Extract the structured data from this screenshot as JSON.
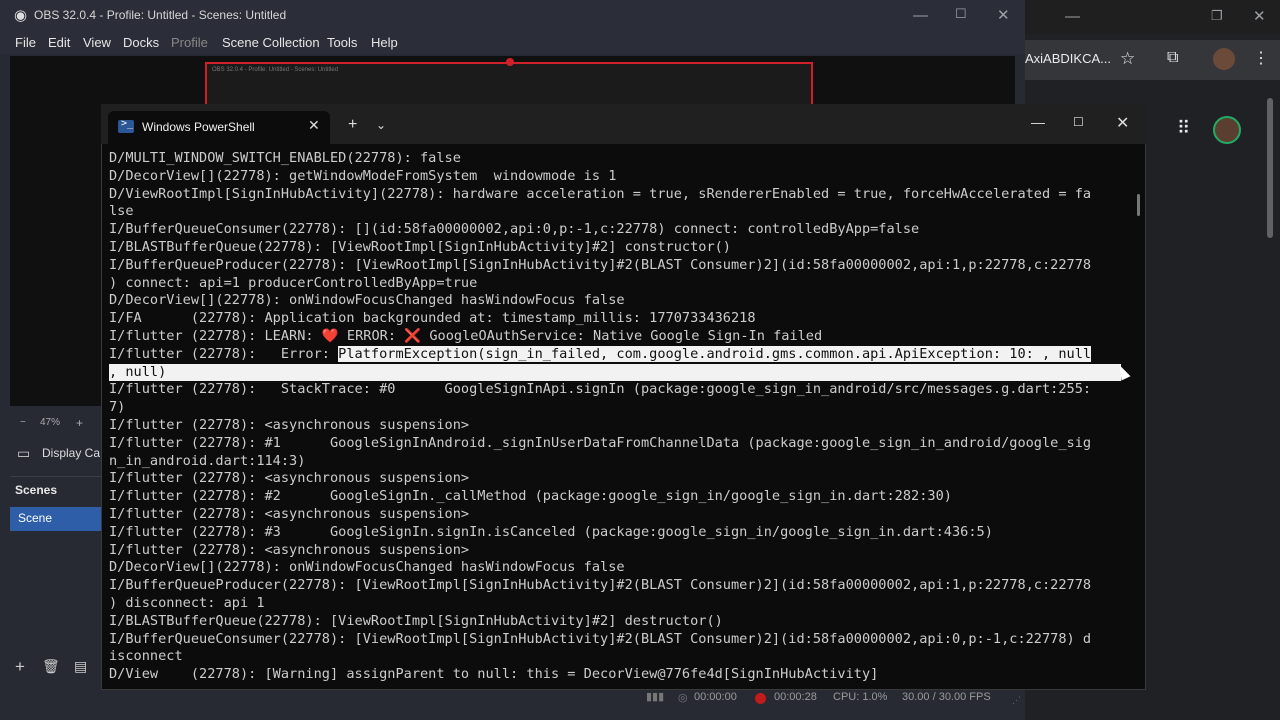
{
  "obs": {
    "title": "OBS 32.0.4 - Profile: Untitled - Scenes: Untitled",
    "menu": [
      "File",
      "Edit",
      "View",
      "Docks",
      "Profile",
      "Scene Collection",
      "Tools",
      "Help"
    ],
    "zoom": "47%",
    "display_capture": "Display Ca",
    "scenes_header": "Scenes",
    "scene_item": "Scene",
    "status": {
      "stream_time": "00:00:00",
      "rec_time": "00:00:28",
      "cpu": "CPU: 1.0%",
      "fps": "30.00 / 30.00 FPS"
    },
    "preview_title": "OBS 32.0.4 - Profile: Untitled - Scenes: Untitled"
  },
  "browser": {
    "address_text": "AxiABDIKCA..."
  },
  "terminal": {
    "tab_title": "Windows PowerShell",
    "lines": [
      "D/MULTI_WINDOW_SWITCH_ENABLED(22778): false",
      "D/DecorView[](22778): getWindowModeFromSystem  windowmode is 1",
      "D/ViewRootImpl[SignInHubActivity](22778): hardware acceleration = true, sRendererEnabled = true, forceHwAccelerated = fa",
      "lse",
      "I/BufferQueueConsumer(22778): [](id:58fa00000002,api:0,p:-1,c:22778) connect: controlledByApp=false",
      "I/BLASTBufferQueue(22778): [ViewRootImpl[SignInHubActivity]#2] constructor()",
      "I/BufferQueueProducer(22778): [ViewRootImpl[SignInHubActivity]#2(BLAST Consumer)2](id:58fa00000002,api:1,p:22778,c:22778",
      ") connect: api=1 producerControlledByApp=true",
      "D/DecorView[](22778): onWindowFocusChanged hasWindowFocus false",
      "I/FA      (22778): Application backgrounded at: timestamp_millis: 1770733436218"
    ],
    "learn_line": {
      "prefix": "I/flutter (22778): LEARN: ",
      "heart": "❤️",
      "mid": " ERROR: ",
      "cross": "❌",
      "suffix": " GoogleOAuthService: Native Google Sign-In failed"
    },
    "error_line": {
      "prefix": "I/flutter (22778):   Error: ",
      "selected": "PlatformException(sign_in_failed, com.google.android.gms.common.api.ApiException: 10: , null",
      "wrap": ", null)"
    },
    "lines2": [
      "I/flutter (22778):   StackTrace: #0      GoogleSignInApi.signIn (package:google_sign_in_android/src/messages.g.dart:255:",
      "7)",
      "I/flutter (22778): <asynchronous suspension>",
      "I/flutter (22778): #1      GoogleSignInAndroid._signInUserDataFromChannelData (package:google_sign_in_android/google_sig",
      "n_in_android.dart:114:3)",
      "I/flutter (22778): <asynchronous suspension>",
      "I/flutter (22778): #2      GoogleSignIn._callMethod (package:google_sign_in/google_sign_in.dart:282:30)",
      "I/flutter (22778): <asynchronous suspension>",
      "I/flutter (22778): #3      GoogleSignIn.signIn.isCanceled (package:google_sign_in/google_sign_in.dart:436:5)",
      "I/flutter (22778): <asynchronous suspension>",
      "D/DecorView[](22778): onWindowFocusChanged hasWindowFocus false",
      "I/BufferQueueProducer(22778): [ViewRootImpl[SignInHubActivity]#2(BLAST Consumer)2](id:58fa00000002,api:1,p:22778,c:22778",
      ") disconnect: api 1",
      "I/BLASTBufferQueue(22778): [ViewRootImpl[SignInHubActivity]#2] destructor()",
      "I/BufferQueueConsumer(22778): [ViewRootImpl[SignInHubActivity]#2(BLAST Consumer)2](id:58fa00000002,api:0,p:-1,c:22778) d",
      "isconnect",
      "D/View    (22778): [Warning] assignParent to null: this = DecorView@776fe4d[SignInHubActivity]"
    ]
  },
  "colors": {
    "terminal_bg": "#0c0c0c",
    "selection_bg": "#f2f2f2",
    "obs_accent": "#2f5ea8",
    "rec_red": "#c21b1b"
  }
}
